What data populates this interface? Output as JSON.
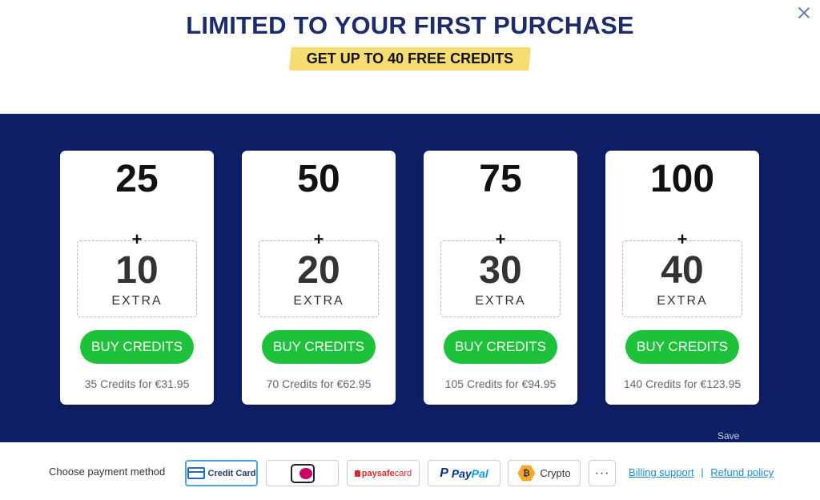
{
  "header": {
    "title": "LIMITED TO YOUR FIRST PURCHASE",
    "ribbon": "GET UP TO 40 FREE CREDITS"
  },
  "colors": {
    "band": "#0f1f66",
    "title": "#1d2a6b",
    "ribbon": "#f7dc71",
    "buy_button": "#1ec23a",
    "link": "#1a8ad4"
  },
  "offers": [
    {
      "base": "25",
      "plus": "+",
      "bonus": "10",
      "extra_label": "EXTRA",
      "button": "BUY CREDITS",
      "price": "35 Credits for €31.95"
    },
    {
      "base": "50",
      "plus": "+",
      "bonus": "20",
      "extra_label": "EXTRA",
      "button": "BUY CREDITS",
      "price": "70 Credits for €62.95"
    },
    {
      "base": "75",
      "plus": "+",
      "bonus": "30",
      "extra_label": "EXTRA",
      "button": "BUY CREDITS",
      "price": "105 Credits for €94.95"
    },
    {
      "base": "100",
      "plus": "+",
      "bonus": "40",
      "extra_label": "EXTRA",
      "button": "BUY CREDITS",
      "price": "140 Credits for €123.95"
    }
  ],
  "ghost_text": "Save",
  "footer": {
    "choose_label": "Choose payment method",
    "methods": [
      {
        "name": "credit-card",
        "label": "Credit Card",
        "icon": "credit-card-icon",
        "selected": true
      },
      {
        "name": "ideal",
        "label": "iDEAL",
        "icon": "ideal-icon"
      },
      {
        "name": "paysafecard",
        "label_bold": "paysafe",
        "label_light": "card",
        "icon": "lock-icon"
      },
      {
        "name": "paypal",
        "label_a": "Pay",
        "label_b": "Pal",
        "icon": "paypal-icon"
      },
      {
        "name": "crypto",
        "label": "Crypto",
        "icon": "bitcoin-icon",
        "icon_glyph": "₿"
      },
      {
        "name": "more",
        "label": "···",
        "icon": "more-icon"
      }
    ],
    "billing_support": "Billing support",
    "separator": "|",
    "refund_policy": "Refund policy"
  }
}
